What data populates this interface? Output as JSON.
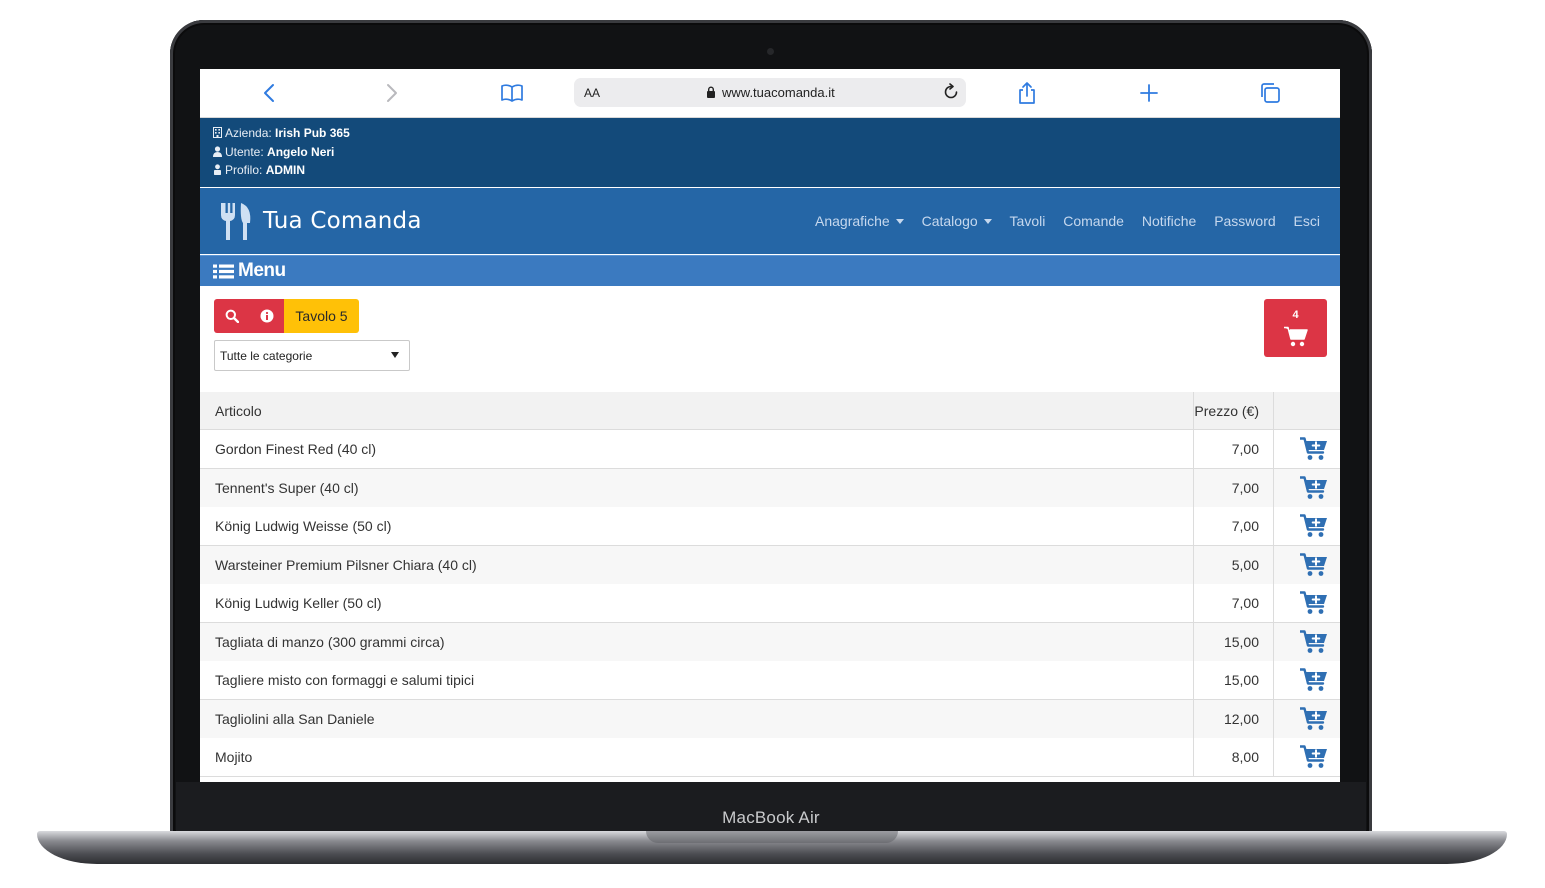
{
  "device": {
    "label": "MacBook Air"
  },
  "browser": {
    "address_aa": "AA",
    "url": "www.tuacomanda.it",
    "icons": [
      "chevron-left-icon",
      "chevron-right-icon",
      "book-icon",
      "lock-icon",
      "reload-icon",
      "share-icon",
      "plus-icon",
      "tabs-icon"
    ]
  },
  "info": {
    "azienda_label": "Azienda:",
    "azienda_value": "Irish Pub 365",
    "utente_label": "Utente:",
    "utente_value": "Angelo Neri",
    "profilo_label": "Profilo:",
    "profilo_value": "ADMIN"
  },
  "nav": {
    "brand": "Tua Comanda",
    "links": [
      "Anagrafiche",
      "Catalogo",
      "Tavoli",
      "Comande",
      "Notifiche",
      "Password",
      "Esci"
    ]
  },
  "menu": {
    "title": "Menu"
  },
  "toolbar": {
    "table_label": "Tavolo 5",
    "category_selected": "Tutte le categorie",
    "cart_count": "4"
  },
  "table": {
    "headers": {
      "article": "Articolo",
      "price": "Prezzo (€)"
    },
    "rows": [
      {
        "name": "Gordon Finest Red (40 cl)",
        "price": "7,00"
      },
      {
        "name": "Tennent's Super (40 cl)",
        "price": "7,00"
      },
      {
        "name": "König Ludwig Weisse (50 cl)",
        "price": "7,00"
      },
      {
        "name": "Warsteiner Premium Pilsner Chiara (40 cl)",
        "price": "5,00"
      },
      {
        "name": "König Ludwig Keller (50 cl)",
        "price": "7,00"
      },
      {
        "name": "Tagliata di manzo (300 grammi circa)",
        "price": "15,00"
      },
      {
        "name": "Tagliere misto con formaggi e salumi tipici",
        "price": "15,00"
      },
      {
        "name": "Tagliolini alla San Daniele",
        "price": "12,00"
      },
      {
        "name": "Mojito",
        "price": "8,00"
      }
    ]
  },
  "colors": {
    "info_bg": "#134a7a",
    "nav_bg": "#2566a6",
    "menu_bg": "#3b7ac0",
    "danger": "#dc3545",
    "warning": "#ffc107",
    "cart_icon": "#2f6fb3"
  }
}
